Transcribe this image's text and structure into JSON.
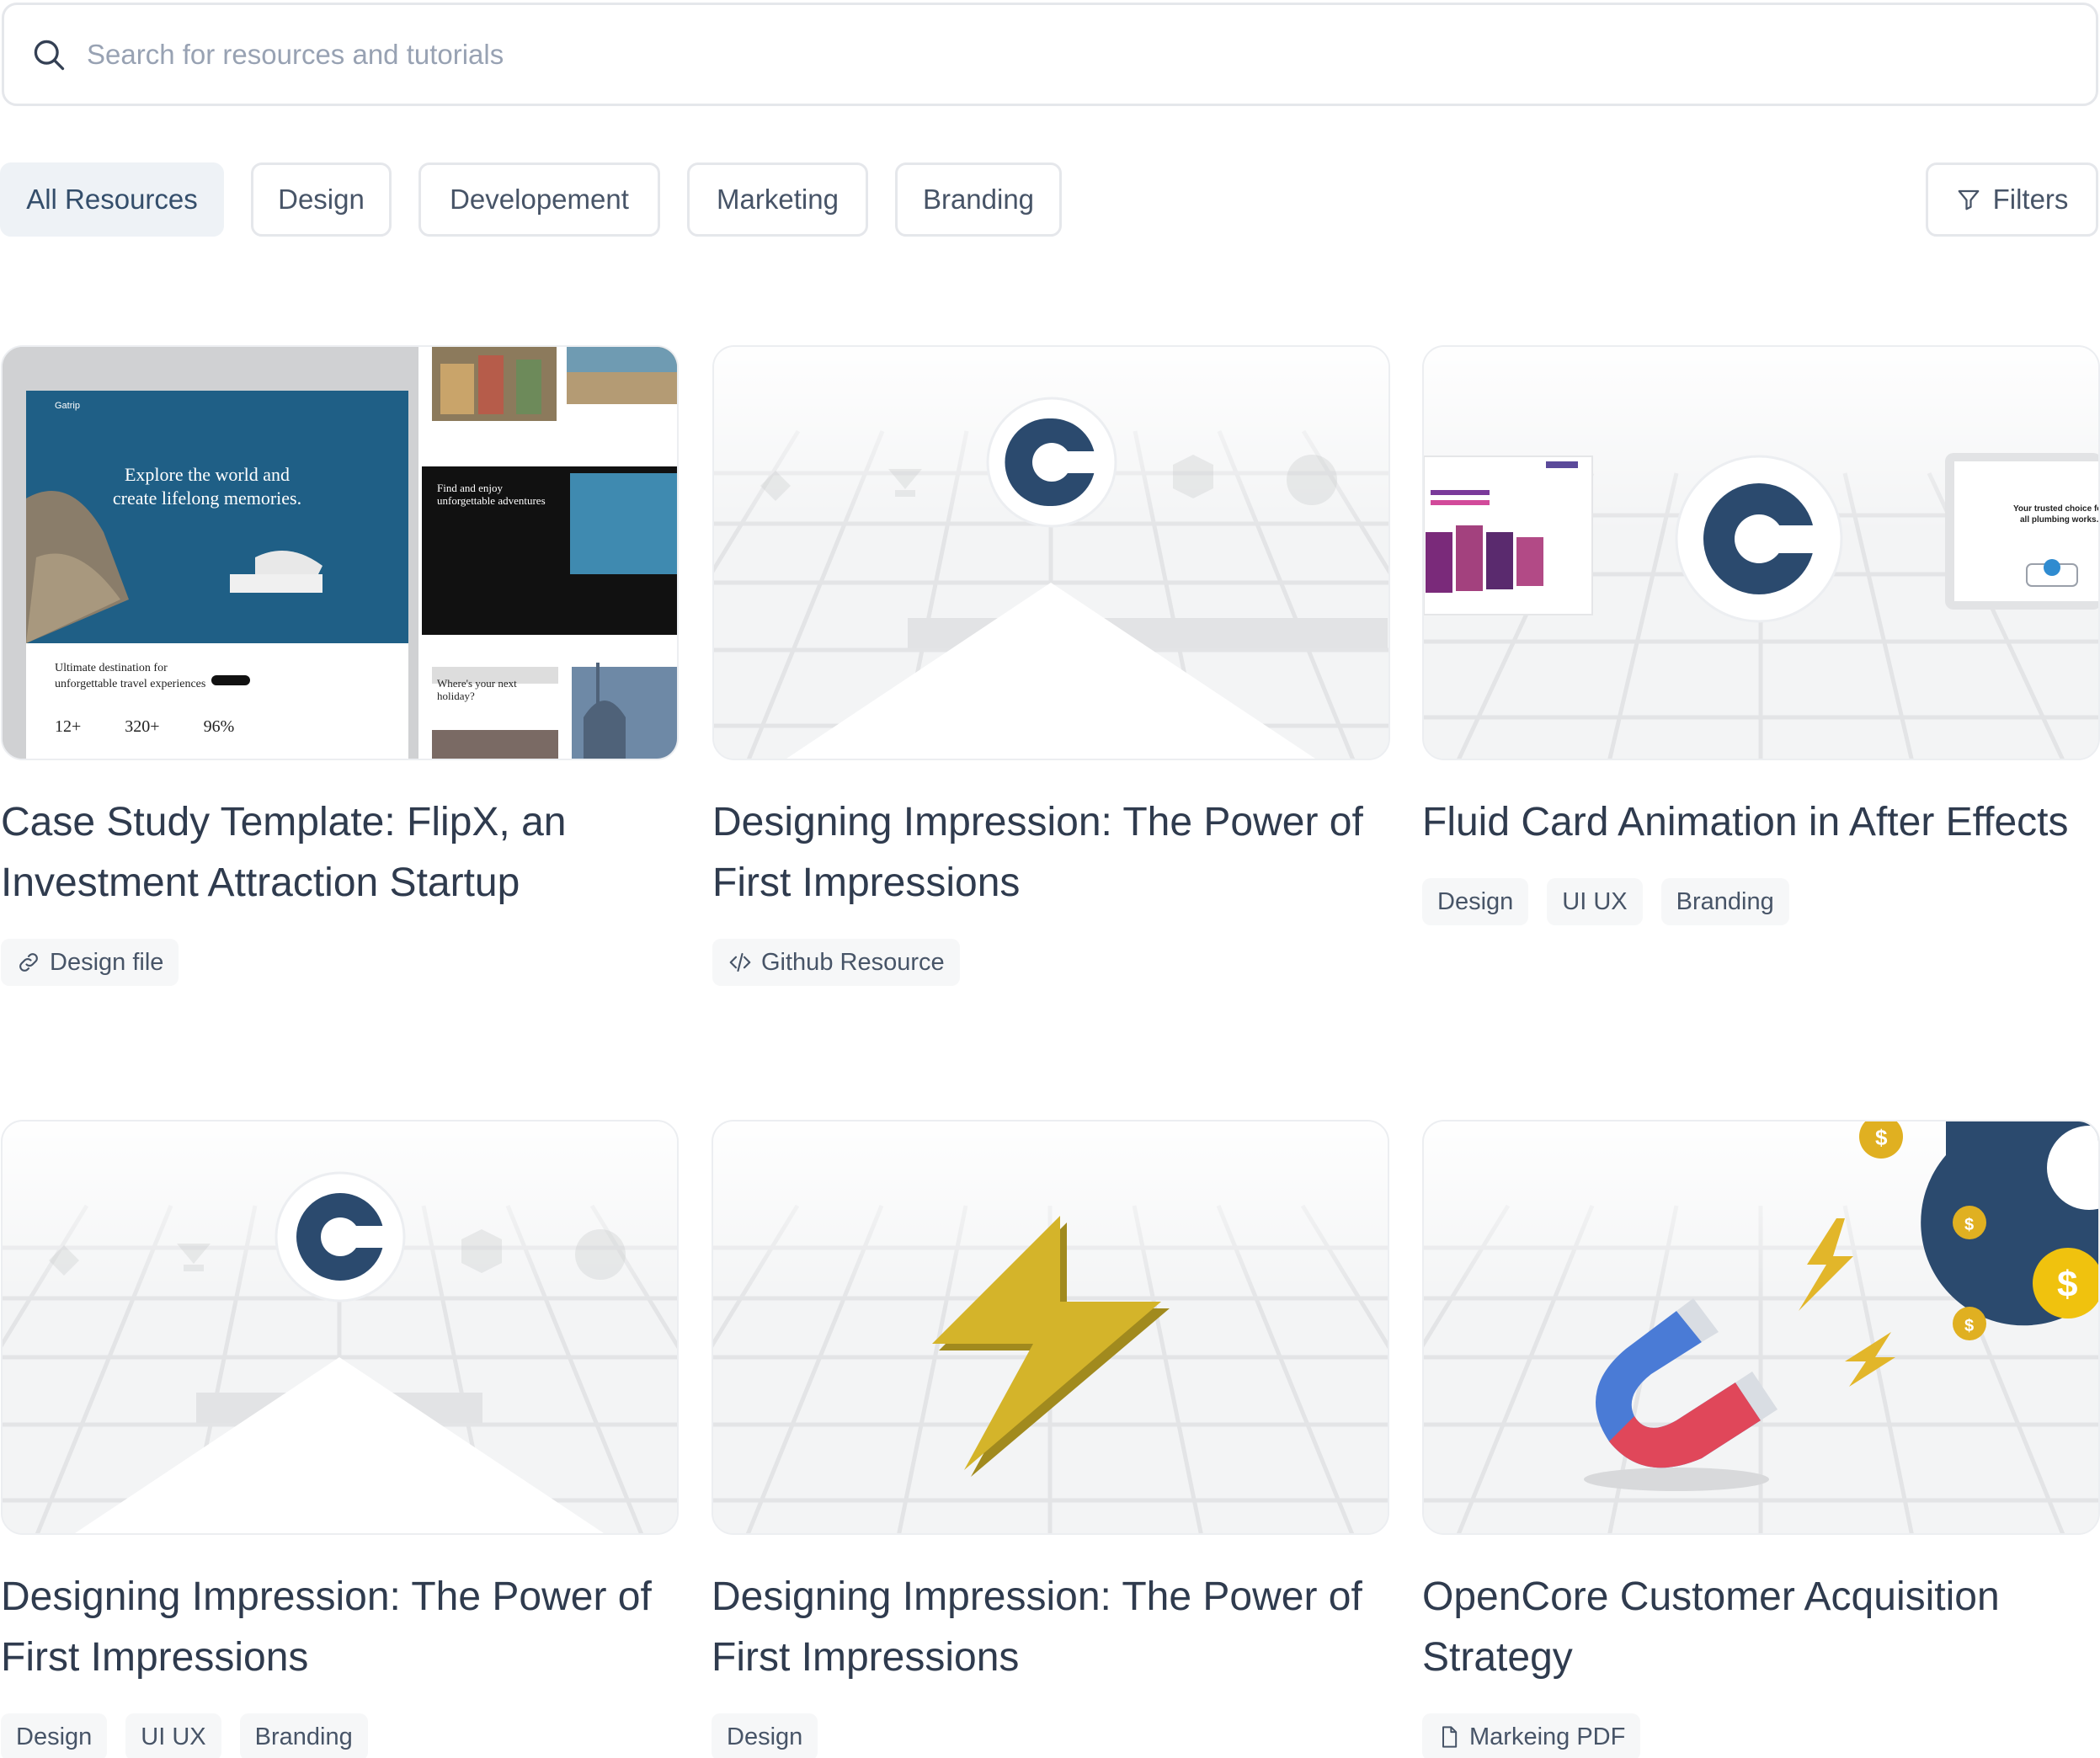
{
  "search": {
    "placeholder": "Search for resources and tutorials",
    "icon": "search-icon"
  },
  "tabs": [
    {
      "label": "All Resources",
      "active": true
    },
    {
      "label": "Design",
      "active": false
    },
    {
      "label": "Developement",
      "active": false
    },
    {
      "label": "Marketing",
      "active": false
    },
    {
      "label": "Branding",
      "active": false
    }
  ],
  "filters": {
    "label": "Filters",
    "icon": "funnel-icon"
  },
  "cards": [
    {
      "title": "Case Study Template: FlipX, an Investment Attraction Startup",
      "tags": [
        {
          "label": "Design file",
          "icon": "link-icon"
        }
      ],
      "preview": {
        "hero_text": "Explore the world and create lifelong memories.",
        "brand": "Gatrip",
        "tagline": "Ultimate destination for unforgettable travel experiences",
        "stats": [
          "12+",
          "320+",
          "96%"
        ],
        "side_heading": "Find and enjoy unforgettable adventures",
        "side_heading_2": "Where's your next holiday?"
      }
    },
    {
      "title": "Designing Impression: The Power of First Impressions",
      "tags": [
        {
          "label": "Github Resource",
          "icon": "code-icon"
        }
      ]
    },
    {
      "title": "Fluid Card Animation in After Effects",
      "tags": [
        {
          "label": "Design"
        },
        {
          "label": "UI UX"
        },
        {
          "label": "Branding"
        }
      ]
    },
    {
      "title": "Designing Impression: The Power of First Impressions",
      "tags": [
        {
          "label": "Design"
        },
        {
          "label": "UI UX"
        },
        {
          "label": "Branding"
        }
      ]
    },
    {
      "title": "Designing Impression: The Power of First Impressions",
      "tags": [
        {
          "label": "Design"
        }
      ]
    },
    {
      "title": "OpenCore Customer Acquisition Strategy",
      "tags": [
        {
          "label": "Markeing PDF",
          "icon": "file-icon"
        }
      ]
    }
  ],
  "colors": {
    "brand_navy": "#2b4a6e",
    "text_heading": "#2f3b4e",
    "text_body": "#475467",
    "active_tab_bg": "#eef2f6",
    "bolt_gold": "#d4b42a"
  }
}
